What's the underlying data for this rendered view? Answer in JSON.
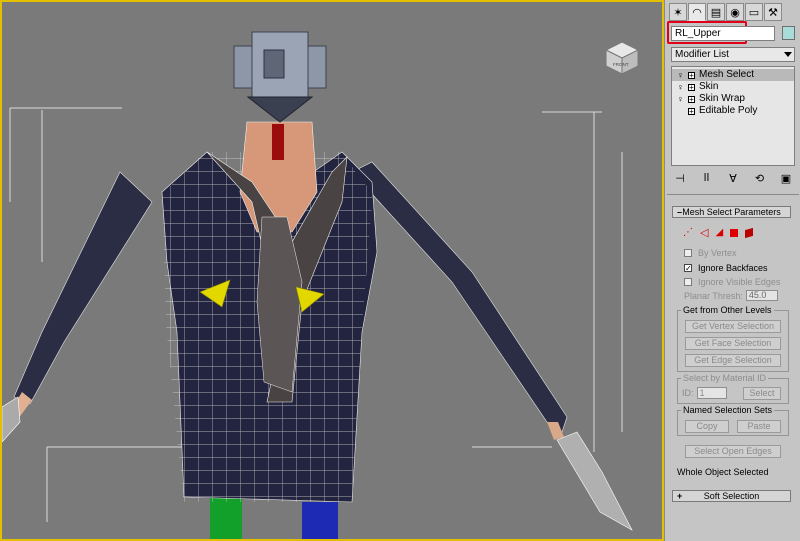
{
  "viewport": {
    "viewcube_label": "FRONT"
  },
  "panel": {
    "tabs": [
      {
        "name": "create-tab",
        "glyph": "✶"
      },
      {
        "name": "modify-tab",
        "glyph": "◠"
      },
      {
        "name": "hierarchy-tab",
        "glyph": "▤"
      },
      {
        "name": "motion-tab",
        "glyph": "◉"
      },
      {
        "name": "display-tab",
        "glyph": "▭"
      },
      {
        "name": "utilities-tab",
        "glyph": "⚒"
      }
    ],
    "object_name": "RL_Upper",
    "object_color": "#a9dcd9",
    "modifier_list_label": "Modifier List",
    "stack": [
      {
        "label": "Mesh Select",
        "selected": true
      },
      {
        "label": "Skin",
        "selected": false
      },
      {
        "label": "Skin Wrap",
        "selected": false
      },
      {
        "label": "Editable Poly",
        "selected": false
      }
    ],
    "stack_tools": [
      "⊣",
      "ǀǀ",
      "∀",
      "⟲",
      "▣"
    ],
    "mesh_select": {
      "title": "Mesh Select Parameters",
      "by_vertex": "By Vertex",
      "ignore_backfaces": "Ignore Backfaces",
      "ignore_visible_edges": "Ignore Visible Edges",
      "planar_thresh_label": "Planar Thresh:",
      "planar_thresh_value": "45.0",
      "get_from_other_levels": "Get from Other Levels",
      "get_vertex": "Get Vertex Selection",
      "get_face": "Get Face Selection",
      "get_edge": "Get Edge Selection",
      "select_by_material_id": "Select by Material ID",
      "id_label": "ID:",
      "id_value": "1",
      "select_btn": "Select",
      "named_selection_sets": "Named Selection Sets",
      "copy_btn": "Copy",
      "paste_btn": "Paste",
      "select_open_edges": "Select Open Edges",
      "status": "Whole Object Selected"
    },
    "soft_selection": "Soft Selection"
  },
  "colors": {
    "viewport_bg": "#7a7a7a",
    "active_border": "#e2c000",
    "highlight": "#e0001a"
  }
}
